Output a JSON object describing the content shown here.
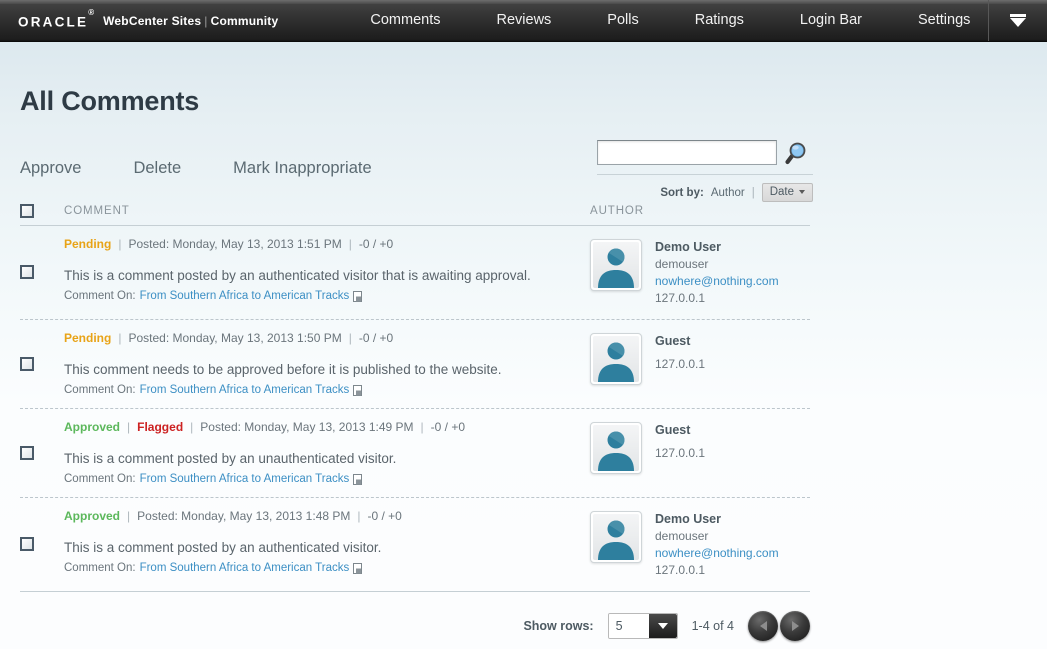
{
  "topbar": {
    "logo": "ORACLE",
    "logo_mark": "®",
    "product": "WebCenter Sites",
    "separator": "|",
    "section": "Community",
    "nav": [
      {
        "label": "Comments",
        "name": "nav-comments"
      },
      {
        "label": "Reviews",
        "name": "nav-reviews"
      },
      {
        "label": "Polls",
        "name": "nav-polls"
      },
      {
        "label": "Ratings",
        "name": "nav-ratings"
      },
      {
        "label": "Login Bar",
        "name": "nav-login-bar"
      },
      {
        "label": "Settings",
        "name": "nav-settings"
      }
    ],
    "menu_toggle_icon": "chevron-down-icon"
  },
  "page": {
    "title": "All Comments",
    "actions": [
      {
        "label": "Approve",
        "name": "approve-action"
      },
      {
        "label": "Delete",
        "name": "delete-action"
      },
      {
        "label": "Mark Inappropriate",
        "name": "mark-inappropriate-action"
      }
    ]
  },
  "search": {
    "value": "",
    "placeholder": "",
    "icon": "search-icon",
    "sort_label": "Sort by:",
    "sort_author": "Author",
    "sort_divider": "|",
    "sort_selected": "Date"
  },
  "table": {
    "header_comment": "COMMENT",
    "header_author": "AUTHOR",
    "rows": [
      {
        "status": "Pending",
        "status_type": "pending",
        "flagged": "",
        "posted": "Posted: Monday, May 13, 2013 1:51 PM",
        "votes": "-0 / +0",
        "body": "This is a comment posted by an authenticated visitor that is awaiting approval.",
        "comment_on_label": "Comment On:",
        "comment_on_link": "From Southern Africa to American Tracks",
        "author_name": "Demo User",
        "author_username": "demouser",
        "author_email": "nowhere@nothing.com",
        "author_ip": "127.0.0.1"
      },
      {
        "status": "Pending",
        "status_type": "pending",
        "flagged": "",
        "posted": "Posted: Monday, May 13, 2013 1:50 PM",
        "votes": "-0 / +0",
        "body": "This comment needs to be approved before it is published to the website.",
        "comment_on_label": "Comment On:",
        "comment_on_link": "From Southern Africa to American Tracks",
        "author_name": "Guest",
        "author_username": "",
        "author_email": "",
        "author_ip": "127.0.0.1"
      },
      {
        "status": "Approved",
        "status_type": "approved",
        "flagged": "Flagged",
        "posted": "Posted: Monday, May 13, 2013 1:49 PM",
        "votes": "-0 / +0",
        "body": "This is a comment posted by an unauthenticated visitor.",
        "comment_on_label": "Comment On:",
        "comment_on_link": "From Southern Africa to American Tracks",
        "author_name": "Guest",
        "author_username": "",
        "author_email": "",
        "author_ip": "127.0.0.1"
      },
      {
        "status": "Approved",
        "status_type": "approved",
        "flagged": "",
        "posted": "Posted: Monday, May 13, 2013 1:48 PM",
        "votes": "-0 / +0",
        "body": "This is a comment posted by an authenticated visitor.",
        "comment_on_label": "Comment On:",
        "comment_on_link": "From Southern Africa to American Tracks",
        "author_name": "Demo User",
        "author_username": "demouser",
        "author_email": "nowhere@nothing.com",
        "author_ip": "127.0.0.1"
      }
    ]
  },
  "footer": {
    "show_rows_label": "Show rows:",
    "show_rows_value": "5",
    "range_text": "1-4 of 4",
    "prev_icon": "chevron-left-icon",
    "next_icon": "chevron-right-icon"
  },
  "colors": {
    "pending": "#e8a317",
    "approved": "#5cb85c",
    "flagged": "#cc2222",
    "link": "#3c8fc4",
    "avatar": "#2e7f9e"
  }
}
